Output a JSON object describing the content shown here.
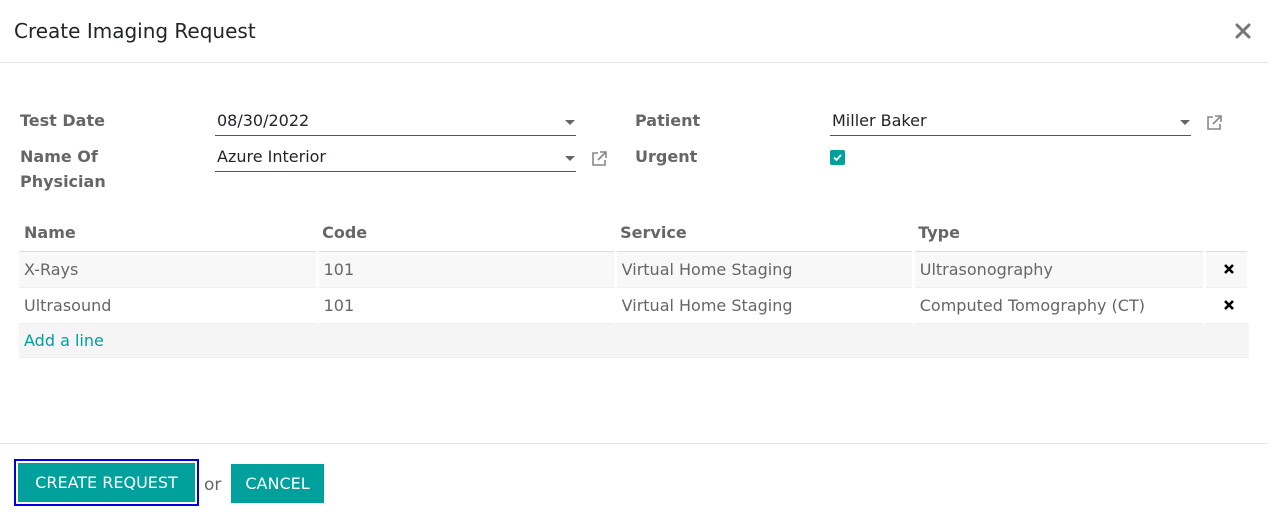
{
  "dialog": {
    "title": "Create Imaging Request",
    "close_label": "×"
  },
  "form": {
    "test_date_label": "Test Date",
    "test_date_value": "08/30/2022",
    "physician_label_line1": "Name Of",
    "physician_label_line2": "Physician",
    "physician_value": "Azure Interior",
    "patient_label": "Patient",
    "patient_value": "Miller Baker",
    "urgent_label": "Urgent",
    "urgent_checked": true
  },
  "table": {
    "columns": [
      "Name",
      "Code",
      "Service",
      "Type"
    ],
    "rows": [
      {
        "name": "X-Rays",
        "code": "101",
        "service": "Virtual Home Staging",
        "type": "Ultrasonography"
      },
      {
        "name": "Ultrasound",
        "code": "101",
        "service": "Virtual Home Staging",
        "type": "Computed Tomography (CT)"
      }
    ],
    "add_line_label": "Add a line"
  },
  "footer": {
    "create_label": "CREATE REQUEST",
    "or_text": "or",
    "cancel_label": "CANCEL"
  },
  "colors": {
    "accent": "#00a09d",
    "focus_outline": "#0000e0",
    "label": "#666666"
  }
}
